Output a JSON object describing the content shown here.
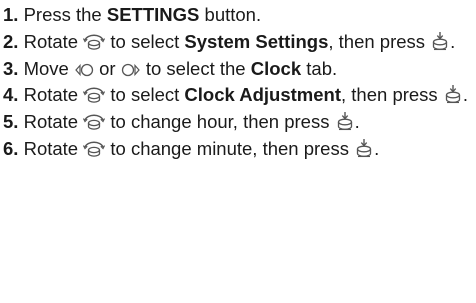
{
  "steps": [
    {
      "num": "1.",
      "t1": "Press the ",
      "b1": "SETTINGS",
      "t2": " button."
    },
    {
      "num": "2.",
      "t1": "Rotate ",
      "t2": " to select ",
      "b1": "System Settings",
      "t3": ", then press ",
      "t4": "."
    },
    {
      "num": "3.",
      "t1": "Move ",
      "t2": " or ",
      "t3": " to select the ",
      "b1": "Clock",
      "t4": " tab."
    },
    {
      "num": "4.",
      "t1": "Rotate ",
      "t2": " to select ",
      "b1": "Clock Adjustment",
      "t3": ", then press ",
      "t4": "."
    },
    {
      "num": "5.",
      "t1": "Rotate ",
      "t2": " to change hour, then press ",
      "t3": "."
    },
    {
      "num": "6.",
      "t1": "Rotate ",
      "t2": " to change minute, then press ",
      "t3": "."
    }
  ],
  "icons": {
    "rotate": "rotate-knob-icon",
    "press": "press-knob-icon",
    "move_left": "move-left-icon",
    "move_right": "move-right-icon"
  },
  "text_color": "#1a1a1a",
  "icon_color": "#555555"
}
